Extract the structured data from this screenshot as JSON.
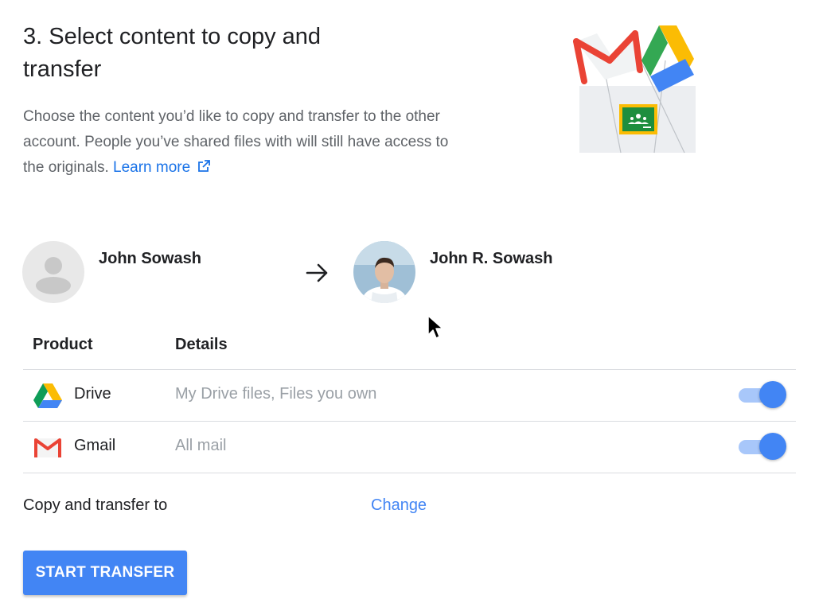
{
  "step": {
    "title": "3. Select content to copy and transfer",
    "description": "Choose the content you’d like to copy and transfer to the other account. People you’ve shared files with will still have access to the originals.",
    "learn_more": "Learn more"
  },
  "accounts": {
    "from": {
      "name": "John Sowash"
    },
    "to": {
      "name": "John R. Sowash"
    }
  },
  "table": {
    "headers": {
      "product": "Product",
      "details": "Details"
    },
    "rows": [
      {
        "product": "Drive",
        "details": "My Drive files, Files you own",
        "enabled": true,
        "icon": "google-drive-icon"
      },
      {
        "product": "Gmail",
        "details": "All mail",
        "enabled": true,
        "icon": "gmail-icon"
      }
    ]
  },
  "destination": {
    "label": "Copy and transfer to",
    "change": "Change"
  },
  "actions": {
    "start_transfer": "START TRANSFER"
  },
  "colors": {
    "accent": "#4285f4",
    "link": "#1a73e8",
    "toggle_track": "#a8c7fa"
  }
}
